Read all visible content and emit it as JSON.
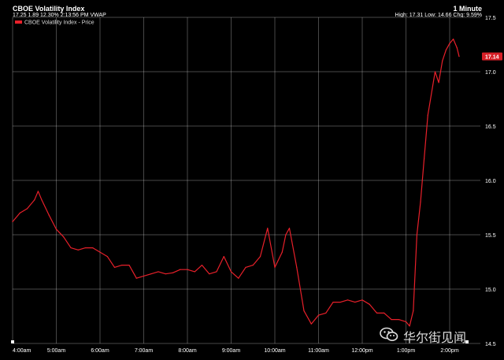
{
  "header": {
    "title": "CBOE Volatility Index",
    "subline": "17.25 1.89 12.30% 2:13:56 PM VWAP",
    "interval": "1 Minute",
    "stats": "High: 17.31 Low: 14.66 Chg: 9.59%"
  },
  "colors": {
    "line": "#e8202a",
    "grid": "#ffffff",
    "background": "#000000",
    "badge": "#d61f26"
  },
  "chart_data": {
    "type": "line",
    "title": "CBOE Volatility Index",
    "legend": "CBOE Volatility Index - Price",
    "legend_position": "top-left",
    "grid": true,
    "x_ticks": [
      "4:00am",
      "5:00am",
      "6:00am",
      "7:00am",
      "8:00am",
      "9:00am",
      "10:00am",
      "11:00am",
      "12:00pm",
      "1:00pm",
      "2:00pm"
    ],
    "y_ticks": [
      "17.5",
      "17.0",
      "16.5",
      "16.0",
      "15.5",
      "15.0",
      "14.5"
    ],
    "ylim": [
      14.5,
      17.5
    ],
    "last_price": "17.14",
    "series": [
      {
        "name": "CBOE Volatility Index - Price",
        "x": [
          "4:00",
          "4:10",
          "4:20",
          "4:30",
          "4:35",
          "4:40",
          "4:50",
          "5:00",
          "5:10",
          "5:20",
          "5:30",
          "5:40",
          "5:50",
          "6:00",
          "6:10",
          "6:20",
          "6:30",
          "6:40",
          "6:50",
          "7:00",
          "7:10",
          "7:20",
          "7:30",
          "7:40",
          "7:50",
          "8:00",
          "8:10",
          "8:20",
          "8:30",
          "8:40",
          "8:50",
          "9:00",
          "9:10",
          "9:20",
          "9:30",
          "9:40",
          "9:50",
          "10:00",
          "10:10",
          "10:15",
          "10:20",
          "10:30",
          "10:40",
          "10:50",
          "11:00",
          "11:10",
          "11:20",
          "11:30",
          "11:40",
          "11:50",
          "12:00",
          "12:10",
          "12:20",
          "12:30",
          "12:40",
          "12:50",
          "13:00",
          "13:05",
          "13:10",
          "13:15",
          "13:20",
          "13:25",
          "13:30",
          "13:40",
          "13:45",
          "13:50",
          "13:55",
          "14:00",
          "14:05",
          "14:10",
          "14:13"
        ],
        "y": [
          15.62,
          15.7,
          15.74,
          15.82,
          15.9,
          15.82,
          15.68,
          15.55,
          15.48,
          15.38,
          15.36,
          15.38,
          15.38,
          15.34,
          15.3,
          15.2,
          15.22,
          15.22,
          15.1,
          15.12,
          15.14,
          15.16,
          15.14,
          15.15,
          15.18,
          15.18,
          15.16,
          15.22,
          15.14,
          15.16,
          15.3,
          15.16,
          15.1,
          15.2,
          15.22,
          15.3,
          15.56,
          15.2,
          15.34,
          15.5,
          15.56,
          15.2,
          14.8,
          14.68,
          14.76,
          14.78,
          14.88,
          14.88,
          14.9,
          14.88,
          14.9,
          14.86,
          14.78,
          14.78,
          14.72,
          14.72,
          14.7,
          14.66,
          14.8,
          15.5,
          15.8,
          16.2,
          16.6,
          17.0,
          16.9,
          17.1,
          17.2,
          17.26,
          17.3,
          17.22,
          17.14
        ]
      }
    ]
  },
  "watermark": {
    "text": "华尔街见闻",
    "icon": "wechat-icon"
  }
}
